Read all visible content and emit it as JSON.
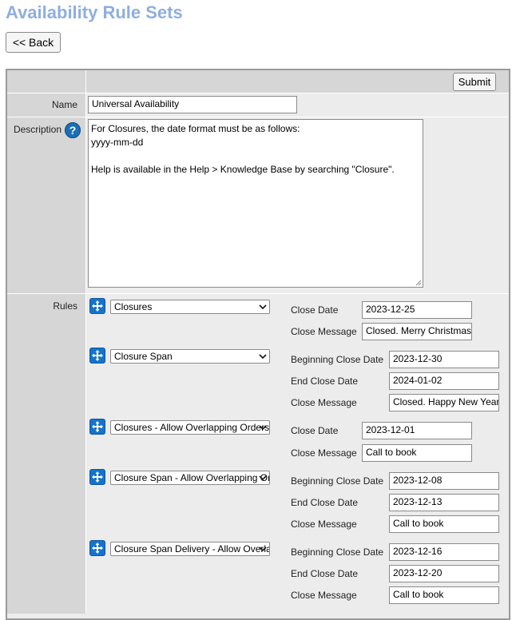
{
  "page": {
    "title": "Availability Rule Sets",
    "back_label": "<< Back"
  },
  "form": {
    "submit_label": "Submit",
    "name_label": "Name",
    "name_value": "Universal Availability",
    "description_label": "Description",
    "description_value": "For Closures, the date format must be as follows:\nyyyy-mm-dd\n\nHelp is available in the Help > Knowledge Base by searching \"Closure\".",
    "help_icon": "?",
    "rules_label": "Rules"
  },
  "rules": [
    {
      "type": "Closures",
      "fields": [
        {
          "label": "Close Date",
          "value": "2023-12-25"
        },
        {
          "label": "Close Message",
          "value": "Closed. Merry Christmas"
        }
      ]
    },
    {
      "type": "Closure Span",
      "fields": [
        {
          "label": "Beginning Close Date",
          "value": "2023-12-30"
        },
        {
          "label": "End Close Date",
          "value": "2024-01-02"
        },
        {
          "label": "Close Message",
          "value": "Closed. Happy New Year"
        }
      ]
    },
    {
      "type": "Closures - Allow Overlapping Orders",
      "fields": [
        {
          "label": "Close Date",
          "value": "2023-12-01"
        },
        {
          "label": "Close Message",
          "value": "Call to book"
        }
      ]
    },
    {
      "type": "Closure Span - Allow Overlapping Orders",
      "fields": [
        {
          "label": "Beginning Close Date",
          "value": "2023-12-08"
        },
        {
          "label": "End Close Date",
          "value": "2023-12-13"
        },
        {
          "label": "Close Message",
          "value": "Call to book"
        }
      ]
    },
    {
      "type": "Closure Span Delivery - Allow Overlapping Orders",
      "fields": [
        {
          "label": "Beginning Close Date",
          "value": "2023-12-16"
        },
        {
          "label": "End Close Date",
          "value": "2023-12-20"
        },
        {
          "label": "Close Message",
          "value": "Call to book"
        }
      ]
    }
  ]
}
